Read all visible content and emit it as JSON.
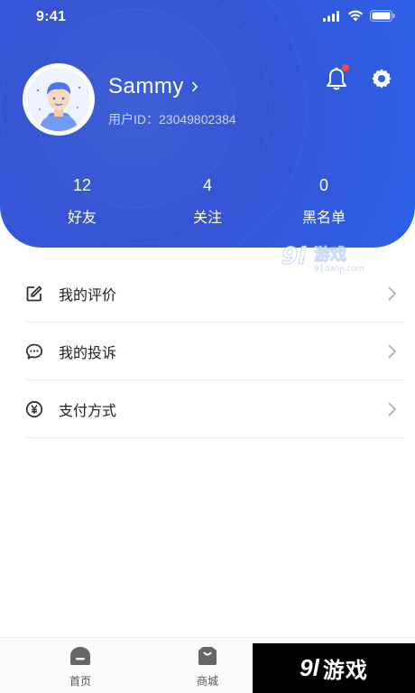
{
  "status_bar": {
    "time": "9:41"
  },
  "profile": {
    "name": "Sammy",
    "user_id": "用户ID：23049802384"
  },
  "stats": [
    {
      "value": "12",
      "label": "好友"
    },
    {
      "value": "4",
      "label": "关注"
    },
    {
      "value": "0",
      "label": "黑名单"
    }
  ],
  "menu": [
    {
      "label": "我的评价",
      "icon": "edit-icon"
    },
    {
      "label": "我的投诉",
      "icon": "chat-icon"
    },
    {
      "label": "支付方式",
      "icon": "yuan-icon"
    }
  ],
  "tabs": [
    {
      "label": "首页",
      "icon": "home-icon"
    },
    {
      "label": "商城",
      "icon": "shop-icon"
    }
  ],
  "watermark": {
    "number": "9l",
    "text": "游戏",
    "sub": "91danji.com"
  },
  "colors": {
    "header_start": "#3a56d4",
    "header_end": "#2b66ea",
    "notification_dot": "#f04a4a"
  }
}
